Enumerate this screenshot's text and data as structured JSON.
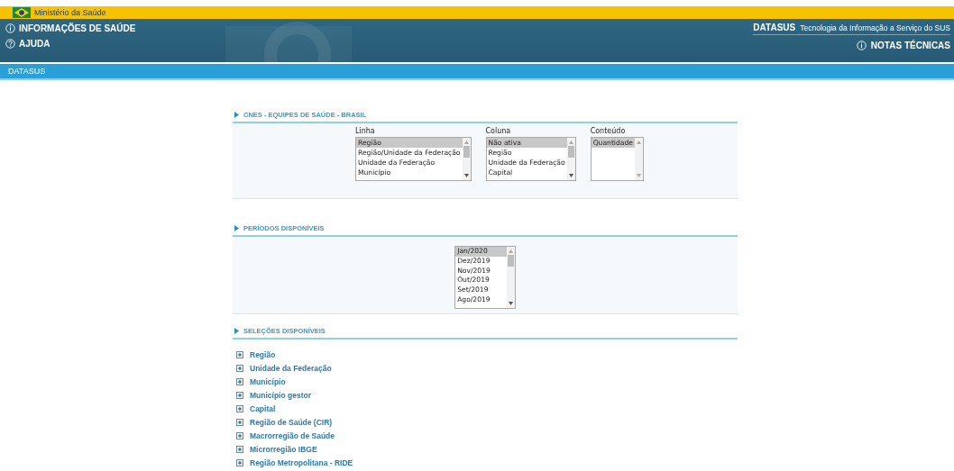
{
  "top_bar": {
    "title": "Ministério da Saúde"
  },
  "header": {
    "left_links": [
      {
        "label": "INFORMAÇÕES DE SAÚDE"
      },
      {
        "label": "AJUDA"
      }
    ],
    "brand": "DATASUS",
    "tagline": "Tecnologia da Informação a Serviço do SUS",
    "right_link": {
      "label": "NOTAS TÉCNICAS"
    }
  },
  "nav_bar": {
    "label": "DATASUS"
  },
  "sections": [
    {
      "kind": "selects",
      "title": "CNES - EQUIPES DE SAÚDE - BRASIL",
      "lists": [
        {
          "label": "Linha",
          "options": [
            {
              "text": "Região",
              "selected": true
            },
            {
              "text": "Região/Unidade da Federação",
              "selected": false
            },
            {
              "text": "Unidade da Federação",
              "selected": false
            },
            {
              "text": "Município",
              "selected": false
            }
          ]
        },
        {
          "label": "Coluna",
          "options": [
            {
              "text": "Não ativa",
              "selected": true
            },
            {
              "text": "Região",
              "selected": false
            },
            {
              "text": "Unidade da Federação",
              "selected": false
            },
            {
              "text": "Capital",
              "selected": false
            }
          ]
        },
        {
          "label": "Conteúdo",
          "options": [
            {
              "text": "Quantidade",
              "selected": true
            }
          ]
        }
      ]
    },
    {
      "kind": "periods",
      "title": "PERÍODOS DISPONÍVEIS",
      "lists": [
        {
          "options": [
            {
              "text": "Jan/2020",
              "selected": true
            },
            {
              "text": "Dez/2019",
              "selected": false
            },
            {
              "text": "Nov/2019",
              "selected": false
            },
            {
              "text": "Out/2019",
              "selected": false
            },
            {
              "text": "Set/2019",
              "selected": false
            },
            {
              "text": "Ago/2019",
              "selected": false
            }
          ]
        }
      ]
    },
    {
      "kind": "tree",
      "title": "SELEÇÕES DISPONÍVEIS",
      "items": [
        {
          "label": "Região",
          "expanded": false
        },
        {
          "label": "Unidade da Federação",
          "expanded": false
        },
        {
          "label": "Município",
          "expanded": false
        },
        {
          "label": "Município gestor",
          "expanded": false
        },
        {
          "label": "Capital",
          "expanded": false
        },
        {
          "label": "Região de Saúde (CIR)",
          "expanded": false
        },
        {
          "label": "Macrorregião de Saúde",
          "expanded": false
        },
        {
          "label": "Microrregião IBGE",
          "expanded": false
        },
        {
          "label": "Região Metropolitana - RIDE",
          "expanded": false
        }
      ]
    }
  ]
}
